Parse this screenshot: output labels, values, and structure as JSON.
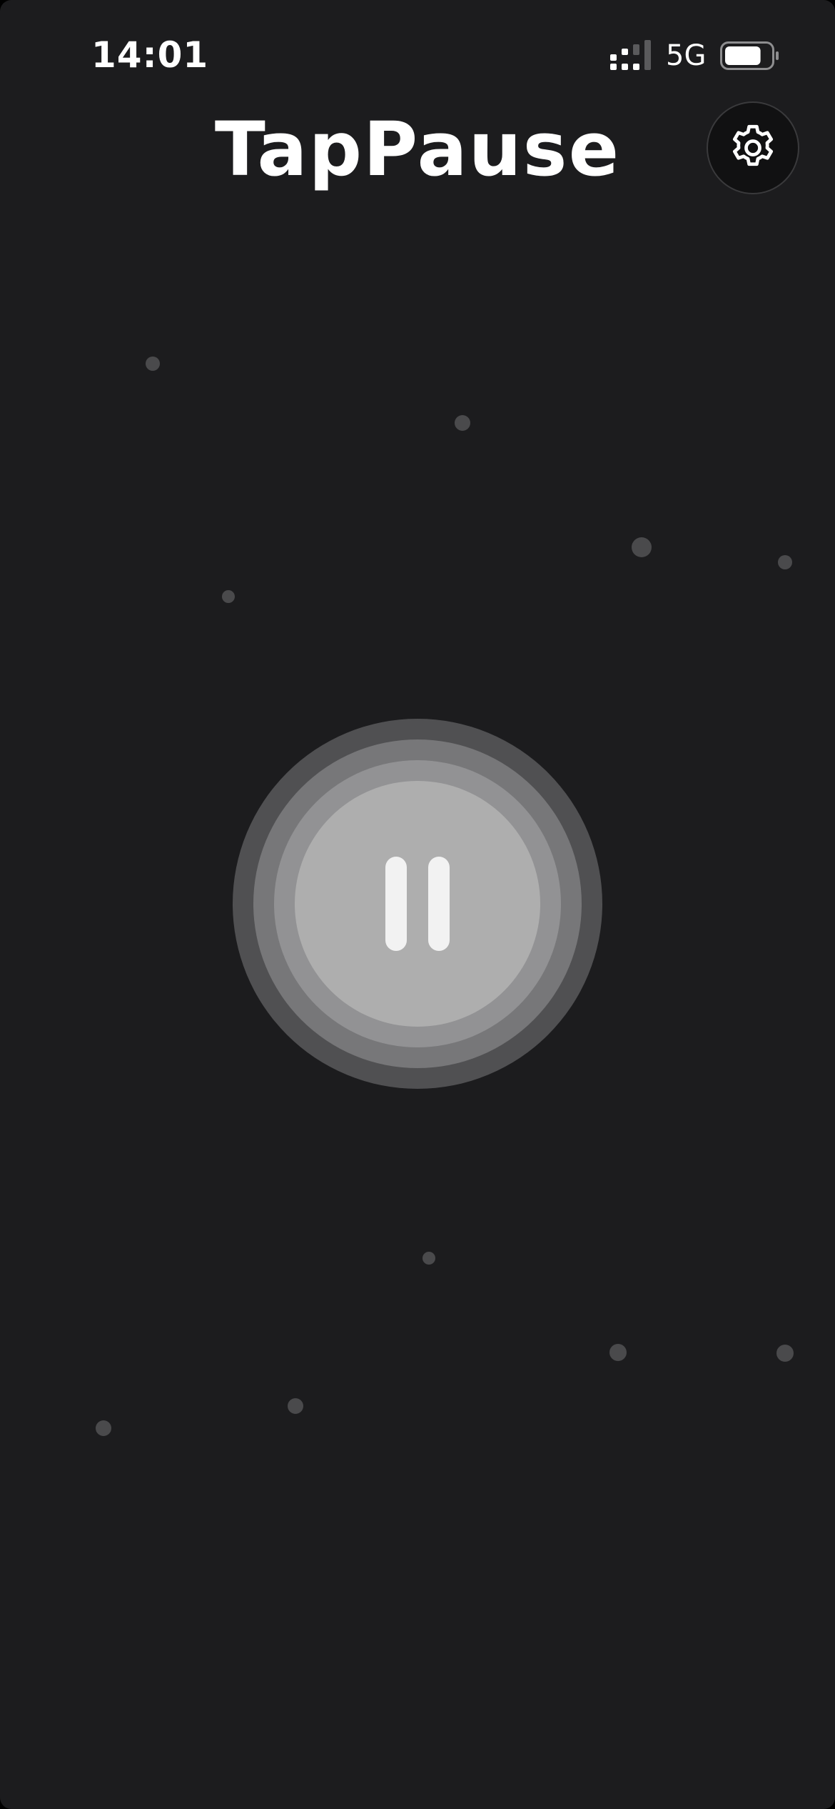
{
  "status_bar": {
    "time": "14:01",
    "network": "5G",
    "signal_bars_filled": 2,
    "signal_bars_total": 4,
    "battery_level": 0.8
  },
  "header": {
    "title": "TapPause",
    "settings_icon": "gear-icon"
  },
  "control": {
    "state": "paused",
    "icon": "pause-icon"
  },
  "colors": {
    "background": "#1c1c1e",
    "accent": "#f2f2f2"
  }
}
